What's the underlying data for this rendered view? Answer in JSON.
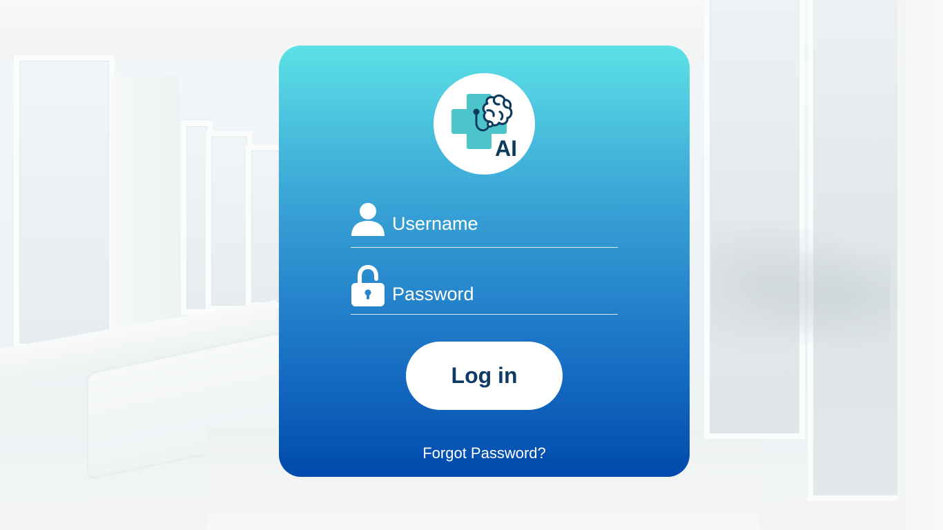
{
  "login": {
    "username_placeholder": "Username",
    "password_placeholder": "Password",
    "login_label": "Log in",
    "forgot_label": "Forgot Password?"
  },
  "logo": {
    "text": "AI",
    "icons": [
      "medical-cross-icon",
      "brain-icon",
      "stethoscope-icon"
    ]
  },
  "icons": {
    "username": "user-icon",
    "password": "unlocked-padlock-icon"
  },
  "colors": {
    "card_gradient_top": "#5ce1e6",
    "card_gradient_bottom": "#004aad",
    "button_text": "#0d3b66",
    "logo_cross": "#4cc4c9",
    "logo_dark": "#0d3b5e"
  }
}
